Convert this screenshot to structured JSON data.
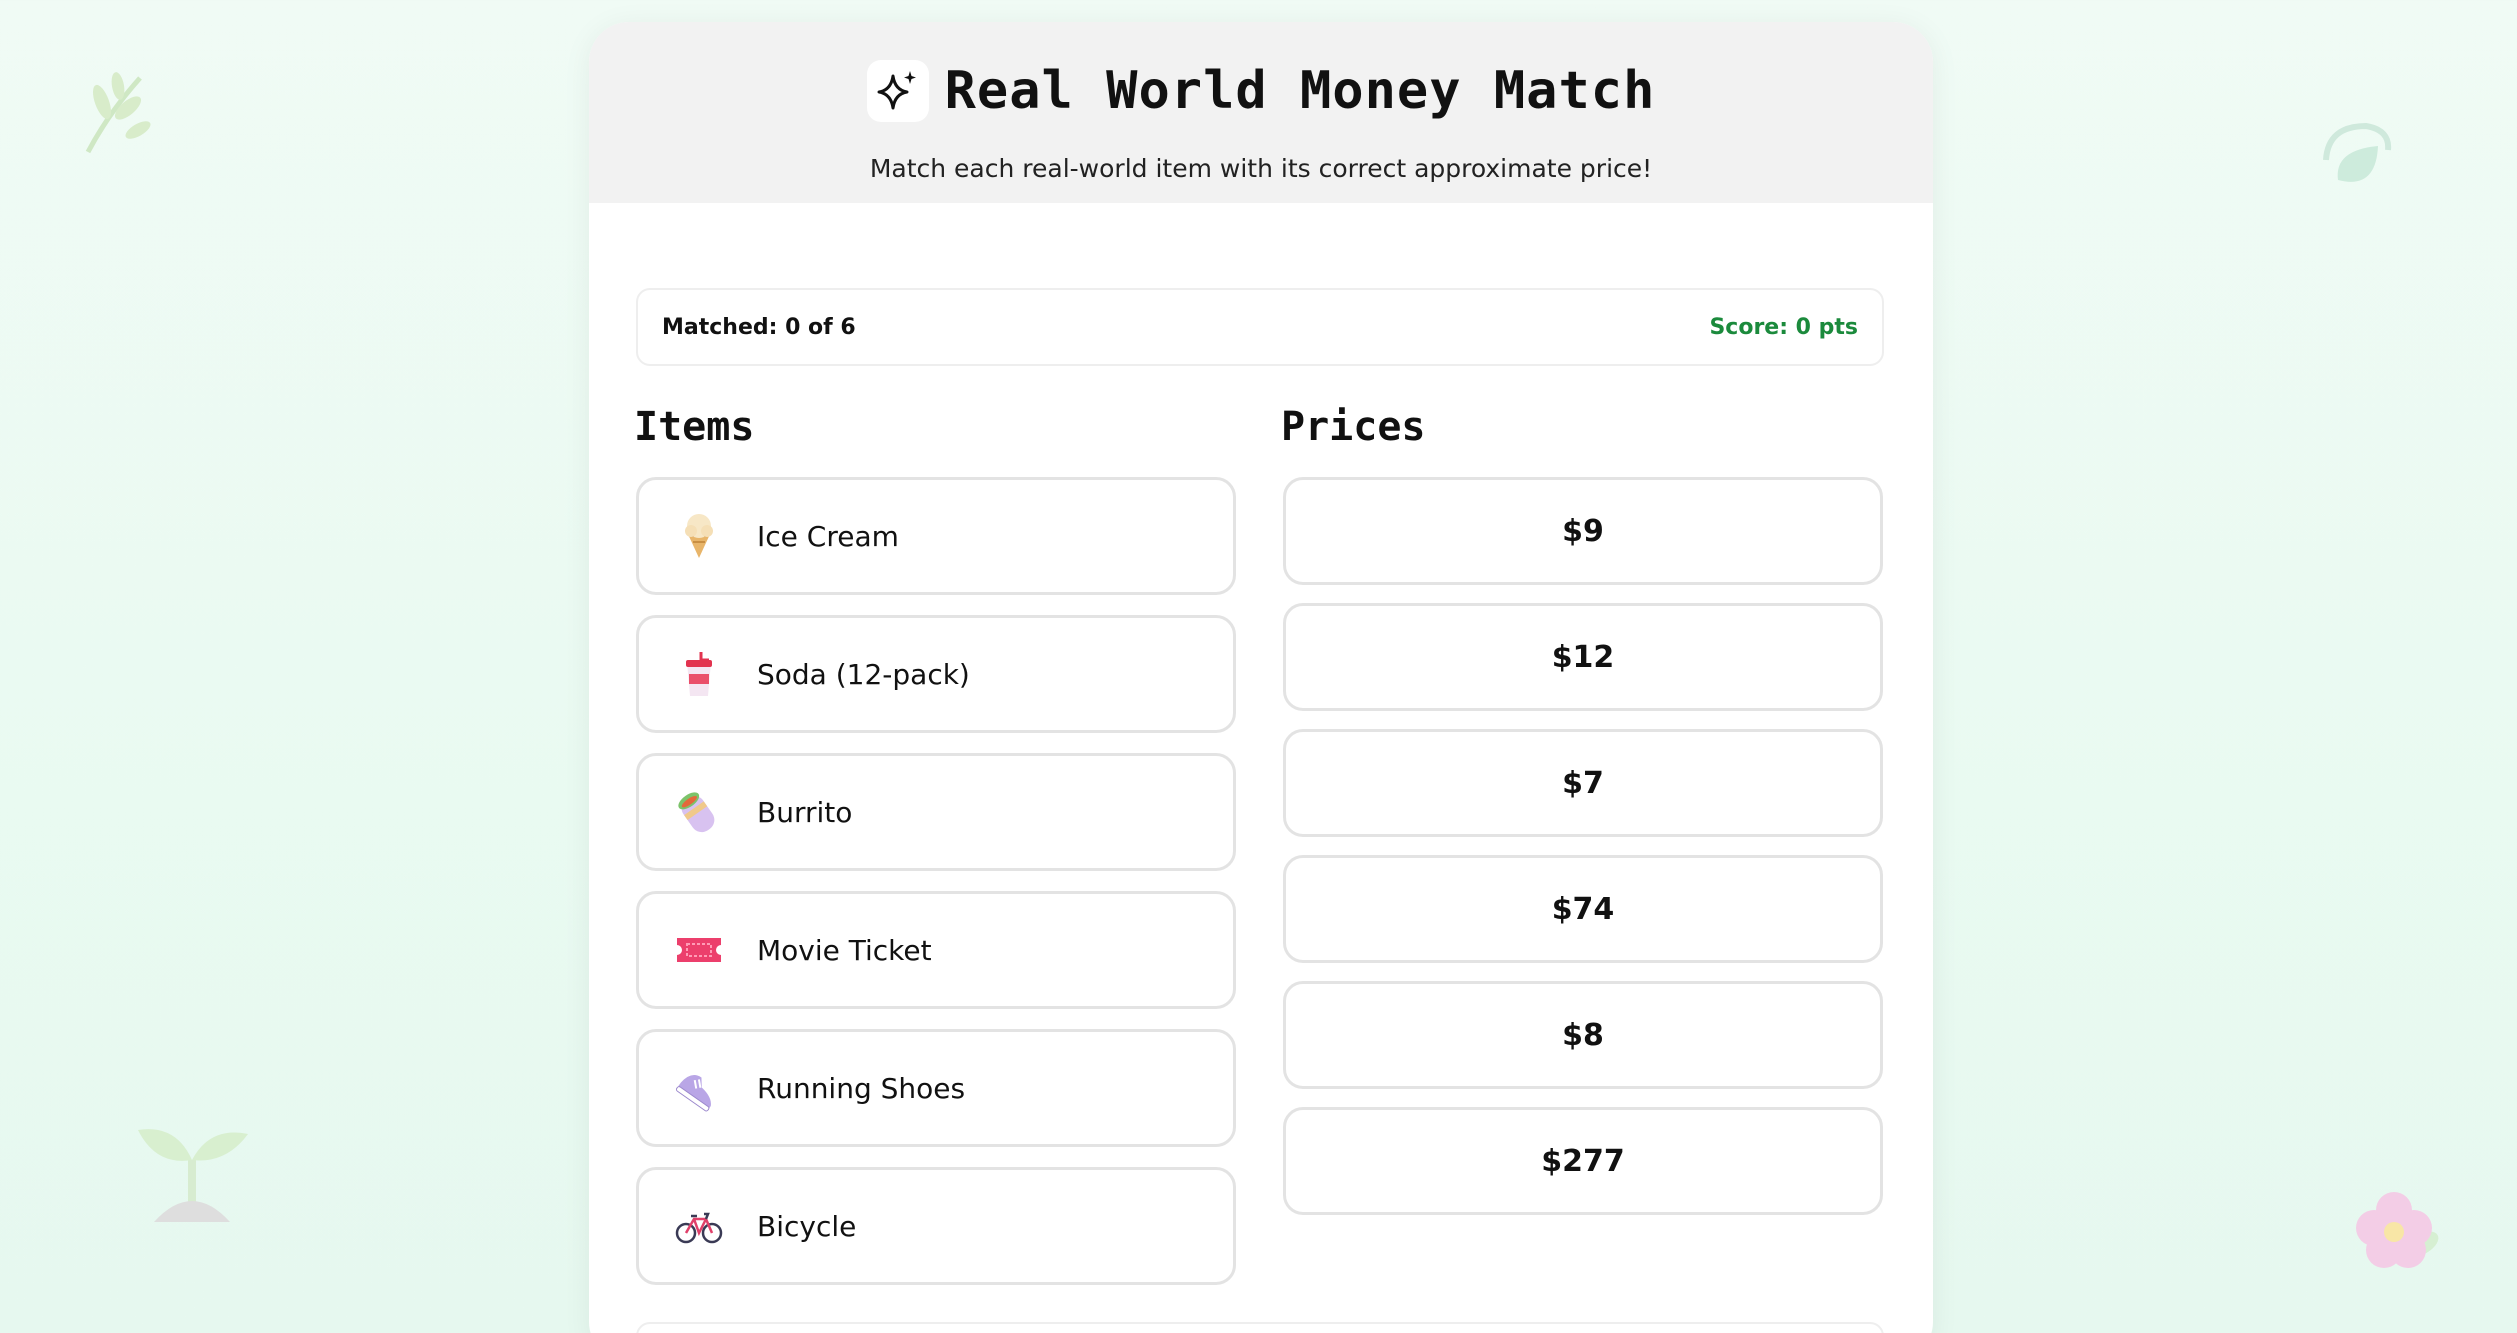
{
  "header": {
    "title": "Real World Money Match",
    "subtitle": "Match each real-world item with its correct approximate price!",
    "title_icon": "sparkle-icon"
  },
  "status": {
    "matched": "Matched: 0 of 6",
    "score": "Score: 0 pts"
  },
  "columns": {
    "items_heading": "Items",
    "prices_heading": "Prices"
  },
  "items": [
    {
      "label": "Ice Cream",
      "icon": "ice-cream-icon"
    },
    {
      "label": "Soda (12-pack)",
      "icon": "soda-cup-icon"
    },
    {
      "label": "Burrito",
      "icon": "burrito-icon"
    },
    {
      "label": "Movie Ticket",
      "icon": "ticket-icon"
    },
    {
      "label": "Running Shoes",
      "icon": "running-shoe-icon"
    },
    {
      "label": "Bicycle",
      "icon": "bicycle-icon"
    }
  ],
  "prices": [
    "$9",
    "$12",
    "$7",
    "$74",
    "$8",
    "$277"
  ],
  "colors": {
    "background": "#edfaf3",
    "header_bg": "#f2f2f2",
    "score": "#1b8a3c",
    "card_border": "#e3e3e3"
  }
}
